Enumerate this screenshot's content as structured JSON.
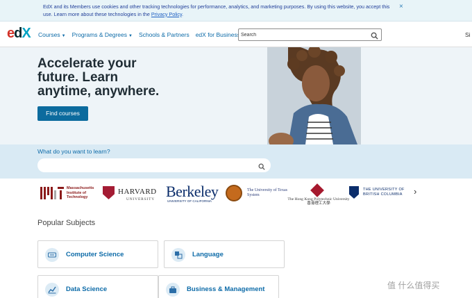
{
  "cookie": {
    "text": "EdX and its Members use cookies and other tracking technologies for performance, analytics, and marketing purposes. By using this website, you accept this use. Learn more about these technologies in the",
    "link": "Privacy Policy",
    "suffix": ".",
    "close": "×"
  },
  "header": {
    "logo": {
      "part1": "e",
      "part2": "d",
      "part3": "X"
    },
    "nav": [
      {
        "label": "Courses",
        "caret": "▼"
      },
      {
        "label": "Programs & Degrees",
        "caret": "▼"
      },
      {
        "label": "Schools & Partners"
      },
      {
        "label": "edX for Business"
      }
    ],
    "search_placeholder": "Search",
    "signin": "Si"
  },
  "hero": {
    "title_lines": [
      "Accelerate your",
      "future. Learn",
      "anytime, anywhere."
    ],
    "cta": "Find courses"
  },
  "band": {
    "label": "What do you want to learn?",
    "search_placeholder": ""
  },
  "partners": {
    "mit": "Massachusetts Institute of Technology",
    "harvard": {
      "name": "HARVARD",
      "sub": "UNIVERSITY"
    },
    "berkeley": {
      "name": "Berkeley",
      "sub": "UNIVERSITY OF CALIFORNIA"
    },
    "texas": "The University of Texas System",
    "hk": "The Hong Kong Polytechnic University 香港理工大學",
    "ubc": "THE UNIVERSITY OF BRITISH COLUMBIA",
    "next": "›"
  },
  "popular": {
    "title": "Popular Subjects",
    "subjects": [
      {
        "label": "Computer Science",
        "icon": "keyboard-icon"
      },
      {
        "label": "Language",
        "icon": "translate-icon"
      },
      {
        "label": "Data Science",
        "icon": "chart-icon"
      },
      {
        "label": "Business & Management",
        "icon": "briefcase-icon"
      }
    ]
  },
  "watermark": "值 什么值得买",
  "colors": {
    "brand_blue": "#0d6ba8",
    "button_blue": "#0c6b9e",
    "band": "#d9eaf4"
  }
}
